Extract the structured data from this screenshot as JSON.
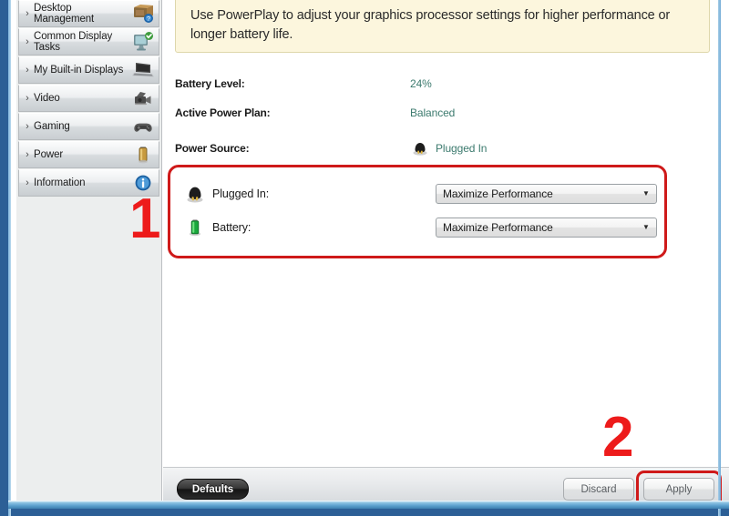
{
  "sidebar": {
    "items": [
      {
        "label": "Desktop Management",
        "icon": "desktop-management-icon",
        "chevron": "›"
      },
      {
        "label": "Common Display Tasks",
        "icon": "common-display-tasks-icon",
        "chevron": "›"
      },
      {
        "label": "My Built-in Displays",
        "icon": "laptop-display-icon",
        "chevron": "›"
      },
      {
        "label": "Video",
        "icon": "camcorder-icon",
        "chevron": "›"
      },
      {
        "label": "Gaming",
        "icon": "gamepad-icon",
        "chevron": "›"
      },
      {
        "label": "Power",
        "icon": "battery-icon",
        "chevron": "›"
      },
      {
        "label": "Information",
        "icon": "info-icon",
        "chevron": "›"
      }
    ]
  },
  "banner": {
    "text": "Use PowerPlay to adjust your graphics processor settings for higher performance or longer battery life."
  },
  "status": {
    "rows": [
      {
        "label": "Battery Level:",
        "value": "24%",
        "icon": ""
      },
      {
        "label": "Active Power Plan:",
        "value": "Balanced",
        "icon": ""
      },
      {
        "label": "Power Source:",
        "value": "Plugged In",
        "icon": "power-plug-icon"
      }
    ]
  },
  "powerplay": {
    "rows": [
      {
        "icon": "power-plug-icon",
        "label": "Plugged In:",
        "selected": "Maximize Performance",
        "arrow": "▼",
        "options": [
          "Maximize Performance"
        ]
      },
      {
        "icon": "battery-icon",
        "label": "Battery:",
        "selected": "Maximize Performance",
        "arrow": "▼",
        "options": [
          "Maximize Performance"
        ]
      }
    ]
  },
  "annotations": {
    "one": "1",
    "two": "2"
  },
  "footer": {
    "defaults_label": "Defaults",
    "discard_label": "Discard",
    "apply_label": "Apply"
  },
  "colors": {
    "annotation_red": "#ed1b1b",
    "highlight_red": "#cf1a1a",
    "value_teal": "#3c7a6e",
    "banner_bg": "#fcf6dd",
    "frame_blue": "#2c5f96"
  }
}
